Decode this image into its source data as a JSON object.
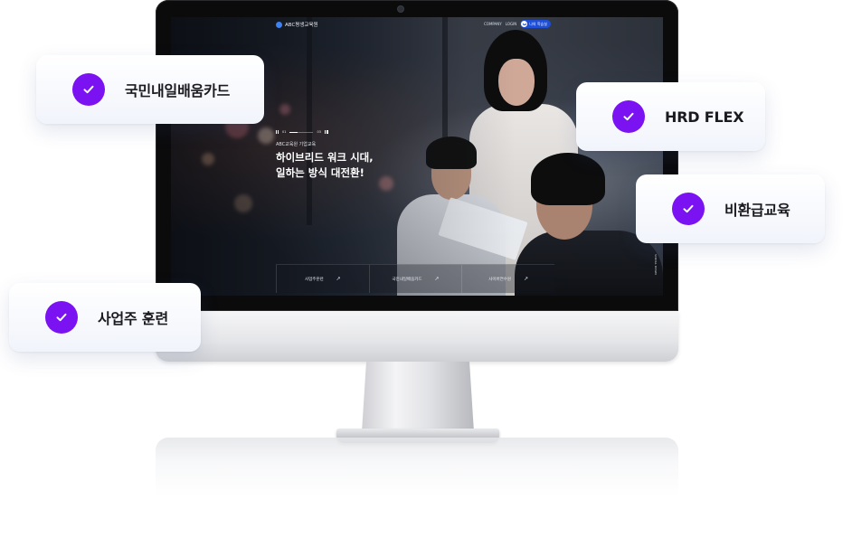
{
  "website": {
    "logo_text": "ABC평생교육원",
    "nav": {
      "company": "COMPANY",
      "login": "LOGIN",
      "my_class": "나의 학습실"
    },
    "hero": {
      "eyebrow": "ABC교육원 기업교육",
      "title_line1": "하이브리드 워크 시대,",
      "title_line2": "일하는 방식 대전환!",
      "slide_current": "01",
      "slide_total": "03",
      "slide_progress": 0.33
    },
    "quick_links": [
      {
        "label": "사업주훈련",
        "arrow": "↗"
      },
      {
        "label": "국민내일배움카드",
        "arrow": "↗"
      },
      {
        "label": "사이버연수원",
        "arrow": "↗"
      }
    ],
    "scroll_hint": "SCROLL DOWN"
  },
  "badges": [
    {
      "label": "국민내일배움카드",
      "icon": "check-icon"
    },
    {
      "label": "HRD FLEX",
      "icon": "check-icon"
    },
    {
      "label": "비환급교육",
      "icon": "check-icon"
    },
    {
      "label": "사업주 훈련",
      "icon": "check-icon"
    }
  ],
  "colors": {
    "accent": "#7a12f2",
    "site_primary": "#1d4ed8"
  }
}
